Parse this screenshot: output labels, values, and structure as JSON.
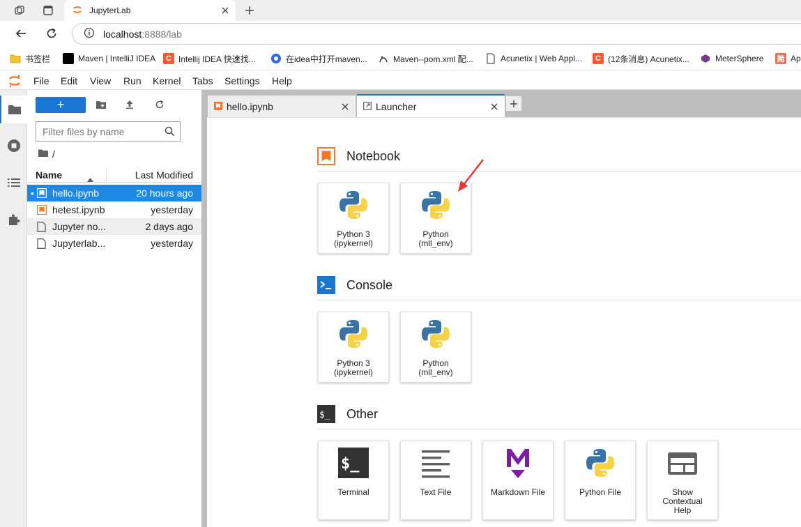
{
  "browser": {
    "tab_title": "JupyterLab",
    "url_host": "localhost",
    "url_rest": ":8888/lab",
    "bookmarks": [
      {
        "label": "书签栏",
        "icon": "folder-icon",
        "color": "#f4c430"
      },
      {
        "label": "Maven | IntelliJ IDEA",
        "icon": "intellij-icon",
        "color": "#000000"
      },
      {
        "label": "Intellij IDEA 快速找...",
        "icon": "csdn-icon",
        "color": "#fc5531"
      },
      {
        "label": "在idea中打开maven...",
        "icon": "blog-icon",
        "color": "#2d6cdf"
      },
      {
        "label": "Maven--pom.xml 配...",
        "icon": "github-icon",
        "color": "#333333"
      },
      {
        "label": "Acunetix | Web Appl...",
        "icon": "page-icon",
        "color": "#777777"
      },
      {
        "label": "(12条消息) Acunetix...",
        "icon": "csdn-icon",
        "color": "#fc5531"
      },
      {
        "label": "MeterSphere",
        "icon": "metersphere-icon",
        "color": "#783887"
      },
      {
        "label": "Apa",
        "icon": "jianshu-icon",
        "color": "#ea6f5a"
      }
    ]
  },
  "menubar": {
    "items": [
      "File",
      "Edit",
      "View",
      "Run",
      "Kernel",
      "Tabs",
      "Settings",
      "Help"
    ]
  },
  "filebrowser": {
    "new_label": "+",
    "filter_placeholder": "Filter files by name",
    "breadcrumb": "/",
    "col_name": "Name",
    "col_modified": "Last Modified",
    "files": [
      {
        "name": "hello.ipynb",
        "modified": "20 hours ago",
        "type": "notebook",
        "running": "•"
      },
      {
        "name": "hetest.ipynb",
        "modified": "yesterday",
        "type": "notebook",
        "running": ""
      },
      {
        "name": "Jupyter no...",
        "modified": "2 days ago",
        "type": "file",
        "running": ""
      },
      {
        "name": "Jupyterlab...",
        "modified": "yesterday",
        "type": "file",
        "running": ""
      }
    ]
  },
  "dock": {
    "tabs": [
      {
        "label": "hello.ipynb",
        "icon": "notebook-icon"
      },
      {
        "label": "Launcher",
        "icon": "launcher-icon"
      }
    ],
    "add_label": "+"
  },
  "launcher": {
    "sections": [
      {
        "title": "Notebook",
        "icon": "notebook-section-icon",
        "cards": [
          {
            "line1": "Python 3",
            "line2": "(ipykernel)",
            "line3": ""
          },
          {
            "line1": "Python",
            "line2": "(mll_env)",
            "line3": ""
          }
        ]
      },
      {
        "title": "Console",
        "icon": "console-section-icon",
        "cards": [
          {
            "line1": "Python 3",
            "line2": "(ipykernel)",
            "line3": ""
          },
          {
            "line1": "Python",
            "line2": "(mll_env)",
            "line3": ""
          }
        ]
      },
      {
        "title": "Other",
        "icon": "other-section-icon",
        "cards": [
          {
            "line1": "Terminal",
            "line2": "",
            "line3": "",
            "icon": "terminal-icon"
          },
          {
            "line1": "Text File",
            "line2": "",
            "line3": "",
            "icon": "text-file-icon"
          },
          {
            "line1": "Markdown File",
            "line2": "",
            "line3": "",
            "icon": "markdown-icon"
          },
          {
            "line1": "Python File",
            "line2": "",
            "line3": "",
            "icon": "python-file-icon"
          },
          {
            "line1": "Show",
            "line2": "Contextual",
            "line3": "Help",
            "icon": "contextual-help-icon"
          }
        ]
      }
    ]
  },
  "colors": {
    "accent": "#1976d2",
    "selected_row": "#1e88e5",
    "jupyter_orange": "#f37726",
    "annotation_arrow": "#e53935"
  }
}
